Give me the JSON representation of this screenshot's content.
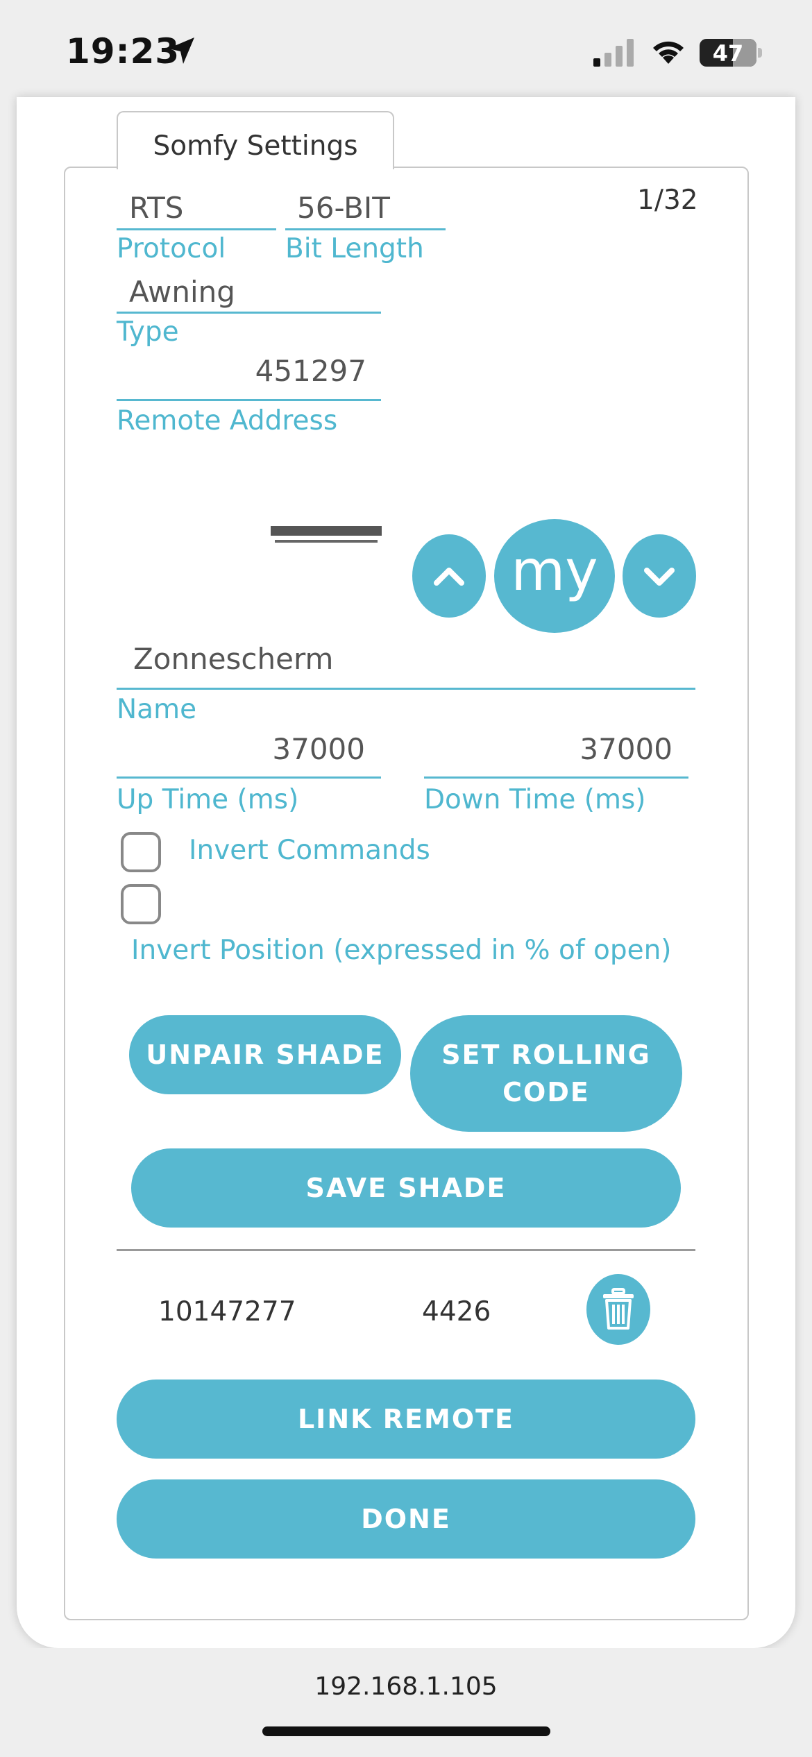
{
  "status_bar": {
    "time": "19:23",
    "battery": "47",
    "icons": [
      "location-arrow-icon",
      "cellular-signal-icon",
      "wifi-icon",
      "battery-icon"
    ]
  },
  "tab": {
    "label": "Somfy Settings"
  },
  "shade": {
    "counter": "1/32",
    "protocol": {
      "value": "RTS",
      "label": "Protocol"
    },
    "bit_length": {
      "value": "56-BIT",
      "label": "Bit Length"
    },
    "type": {
      "value": "Awning",
      "label": "Type"
    },
    "remote_address": {
      "value": "451297",
      "label": "Remote Address"
    },
    "controls": {
      "up_icon": "chevron-up-icon",
      "my_label": "my",
      "down_icon": "chevron-down-icon"
    },
    "name": {
      "value": "Zonnescherm",
      "label": "Name"
    },
    "up_time": {
      "value": "37000",
      "label": "Up Time (ms)"
    },
    "down_time": {
      "value": "37000",
      "label": "Down Time (ms)"
    },
    "invert_commands": {
      "label": "Invert Commands",
      "checked": false
    },
    "invert_position": {
      "label": "Invert Position (expressed in % of open)",
      "checked": false
    }
  },
  "buttons": {
    "unpair": "UNPAIR SHADE",
    "set_rolling_1": "SET ROLLING",
    "set_rolling_2": "CODE",
    "save": "SAVE SHADE",
    "link_remote": "LINK REMOTE",
    "done": "DONE"
  },
  "linked_remotes": [
    {
      "address": "10147277",
      "rolling_code": "4426"
    }
  ],
  "colors": {
    "accent": "#57b8d0",
    "label": "#4fb7cf",
    "background": "#eeeeee"
  },
  "browser": {
    "url": "192.168.1.105"
  }
}
